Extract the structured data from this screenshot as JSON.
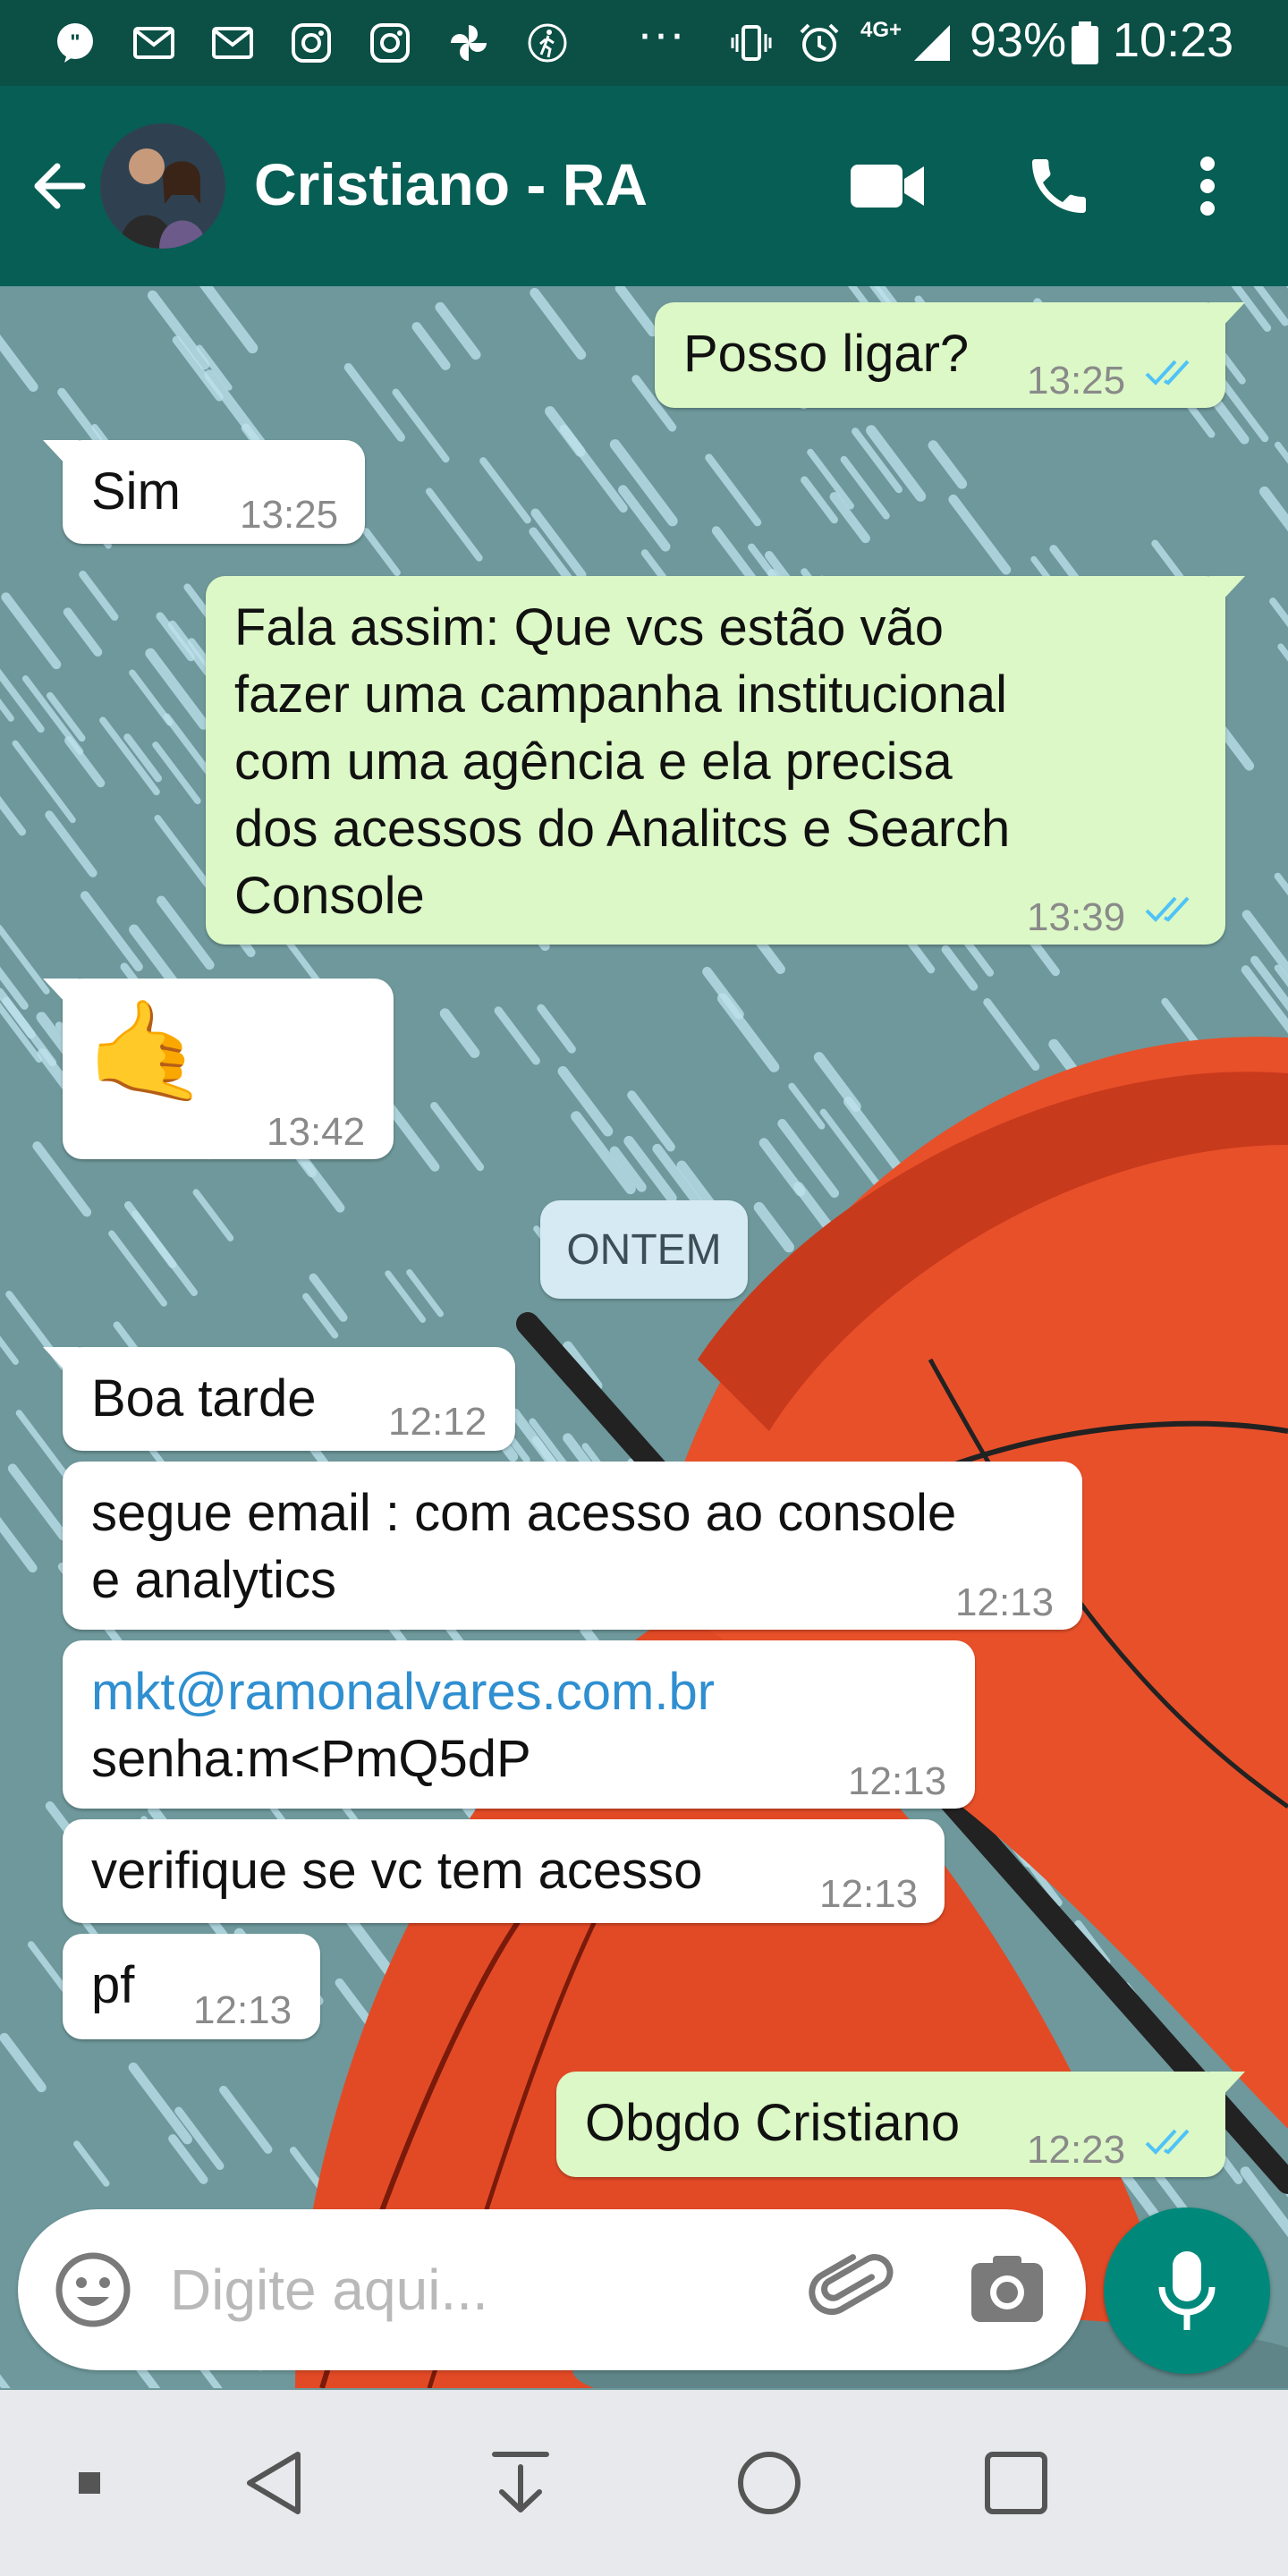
{
  "status_bar": {
    "battery_percent": "93%",
    "time": "10:23",
    "network": "4G+",
    "icons": [
      "quote-icon",
      "gmail-icon",
      "gmail-icon",
      "instagram-icon",
      "instagram-icon",
      "pinwheel-icon",
      "walking-icon",
      "more-dots-icon",
      "vibrate-icon",
      "alarm-icon",
      "network-icon",
      "signal-icon",
      "battery-icon"
    ]
  },
  "header": {
    "title": "Cristiano - RA",
    "icons": [
      "back-arrow-icon",
      "video-call-icon",
      "phone-icon",
      "more-vert-icon"
    ]
  },
  "messages": [
    {
      "direction": "out",
      "text": "Posso ligar?",
      "time": "13:25",
      "read": true
    },
    {
      "direction": "in",
      "text": "Sim",
      "time": "13:25"
    },
    {
      "direction": "out",
      "text": "Fala assim: Que vcs estão vão\nfazer uma campanha institucional\ncom uma agência e ela precisa\ndos acessos do Analitcs e Search\nConsole",
      "time": "13:39",
      "read": true
    },
    {
      "direction": "in",
      "text": "🤙",
      "time": "13:42"
    },
    {
      "direction": "in",
      "text": "Boa tarde",
      "time": "12:12"
    },
    {
      "direction": "in",
      "text": "segue email : com acesso ao console\ne analytics",
      "time": "12:13"
    },
    {
      "direction": "in",
      "link": "mkt@ramonalvares.com.br",
      "text": "senha:m<PmQ5dP",
      "time": "12:13"
    },
    {
      "direction": "in",
      "text": "verifique se vc tem acesso",
      "time": "12:13"
    },
    {
      "direction": "in",
      "text": "pf",
      "time": "12:13"
    },
    {
      "direction": "out",
      "text": "Obgdo Cristiano",
      "time": "12:23",
      "read": true
    }
  ],
  "date_separator": "ONTEM",
  "composer": {
    "placeholder": "Digite aqui..."
  },
  "colors": {
    "header": "#075e54",
    "status_bar": "#0b4f45",
    "outgoing_bubble": "#dcf8c6",
    "incoming_bubble": "#ffffff",
    "read_ticks": "#4fc3f7",
    "mic_button": "#00897b"
  }
}
